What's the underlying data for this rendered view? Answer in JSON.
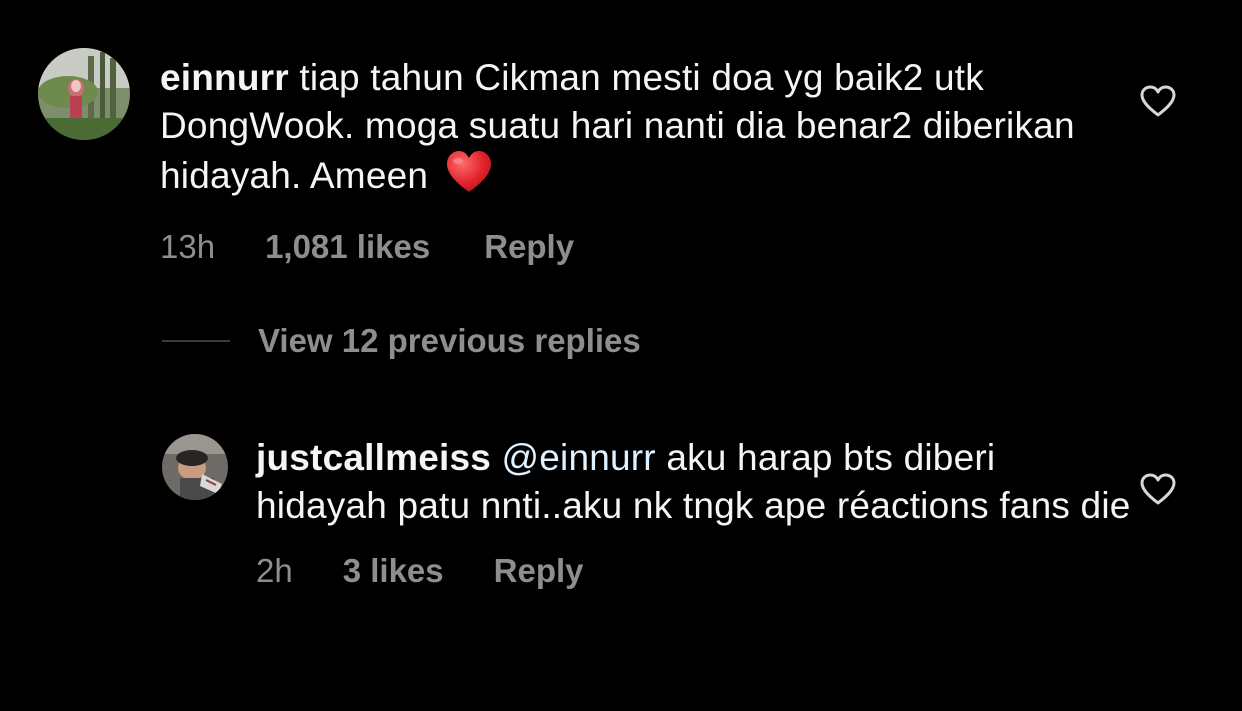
{
  "comments": [
    {
      "username": "einnurr",
      "text": " tiap tahun Cikman mesti doa yg baik2 utk DongWook. moga suatu hari nanti dia benar2 diberikan hidayah. Ameen",
      "emoji": "heart-emoji",
      "time": "13h",
      "likes": "1,081 likes",
      "reply_label": "Reply"
    },
    {
      "username": "justcallmeiss",
      "mention": " @einnurr",
      "text": " aku harap bts diberi hidayah patu nnti..aku nk tngk ape réactions fans die",
      "time": "2h",
      "likes": "3 likes",
      "reply_label": "Reply"
    }
  ],
  "view_replies": {
    "label": "View 12 previous replies"
  },
  "icons": {
    "like": "heart-outline-icon"
  },
  "colors": {
    "background": "#000000",
    "primary_text": "#f5f5f5",
    "secondary_text": "#8e8e8e",
    "heart_emoji": "#e0242c"
  }
}
